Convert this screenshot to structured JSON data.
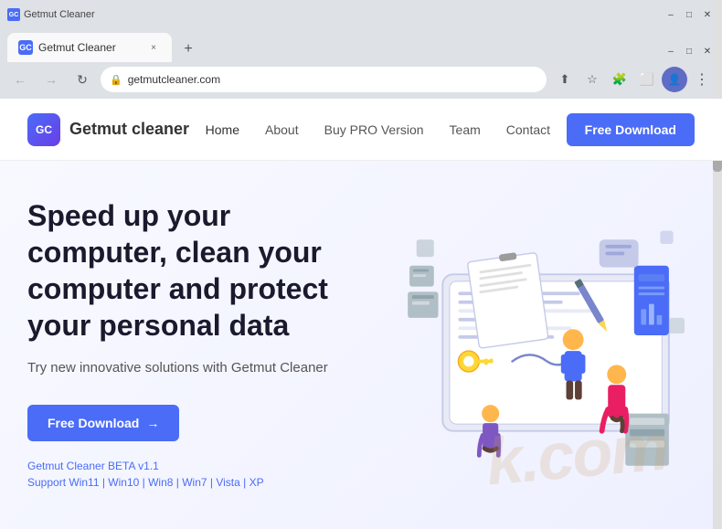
{
  "browser": {
    "title": "Getmut Cleaner",
    "tab_favicon": "GC",
    "tab_close": "×",
    "new_tab": "+",
    "back": "←",
    "forward": "→",
    "reload": "↻",
    "address": "getmutcleaner.com",
    "lock": "🔒",
    "star": "☆",
    "extensions": "🧩",
    "cast": "⬜",
    "profile": "👤",
    "menu": "⋮"
  },
  "nav": {
    "logo_text": "GC",
    "brand": "Getmut cleaner",
    "links": [
      {
        "label": "Home",
        "active": true
      },
      {
        "label": "About",
        "active": false
      },
      {
        "label": "Buy PRO Version",
        "active": false
      },
      {
        "label": "Team",
        "active": false
      },
      {
        "label": "Contact",
        "active": false
      }
    ],
    "cta": "Free Download"
  },
  "hero": {
    "title": "Speed up your computer, clean your computer and protect your personal data",
    "subtitle": "Try new innovative solutions with Getmut Cleaner",
    "cta_label": "Free Download",
    "cta_arrow": "→",
    "version": "Getmut Cleaner BETA v1.1",
    "support": "Support Win11 | Win10 | Win8 | Win7 | Vista | XP"
  },
  "watermark": "k.com"
}
